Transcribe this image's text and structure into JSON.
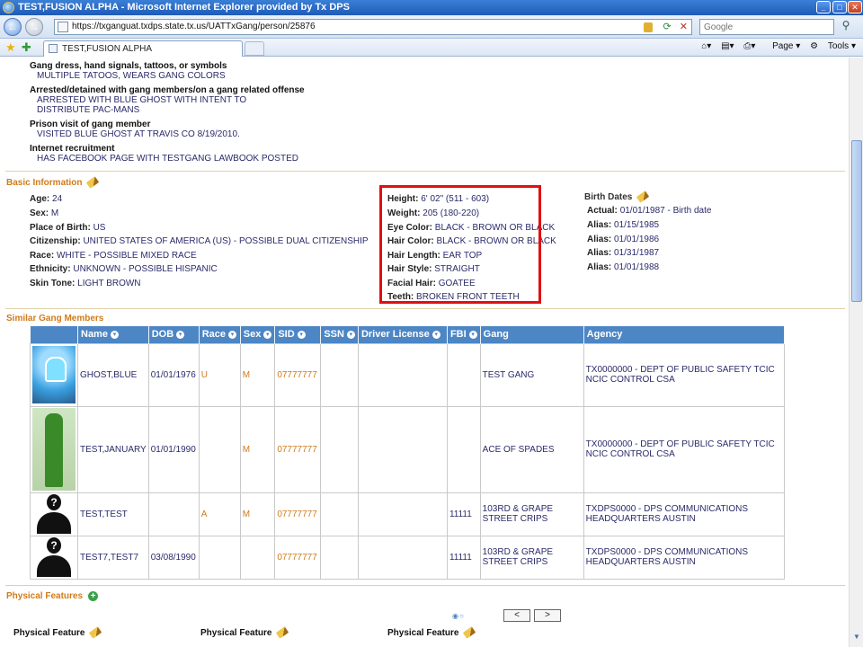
{
  "window": {
    "title": "TEST,FUSION ALPHA - Microsoft Internet Explorer provided by Tx DPS"
  },
  "browser": {
    "url": "https://txganguat.txdps.state.tx.us/UATTxGang/person/25876",
    "search_placeholder": "Google",
    "tab_label": "TEST,FUSION ALPHA",
    "cmd_page": "Page",
    "cmd_tools": "Tools"
  },
  "gang_indicators": [
    {
      "heading": "Gang dress, hand signals, tattoos, or symbols",
      "text": [
        "MULTIPLE TATOOS, WEARS GANG COLORS"
      ]
    },
    {
      "heading": "Arrested/detained with gang members/on a gang related offense",
      "text": [
        "ARRESTED WITH BLUE GHOST WITH INTENT TO",
        "DISTRIBUTE PAC-MANS"
      ]
    },
    {
      "heading": "Prison visit of gang member",
      "text": [
        "VISITED BLUE GHOST AT TRAVIS CO 8/19/2010."
      ]
    },
    {
      "heading": "Internet recruitment",
      "text": [
        "HAS FACEBOOK PAGE WITH TESTGANG LAWBOOK POSTED"
      ]
    }
  ],
  "basic_info": {
    "title": "Basic Information",
    "left": [
      {
        "label": "Age:",
        "value": "24"
      },
      {
        "label": "Sex:",
        "value": "M"
      },
      {
        "label": "Place of Birth:",
        "value": "US"
      },
      {
        "label": "Citizenship:",
        "value": "UNITED STATES OF AMERICA (US) - POSSIBLE DUAL CITIZENSHIP"
      },
      {
        "label": "Race:",
        "value": "WHITE - POSSIBLE MIXED RACE"
      },
      {
        "label": "Ethnicity:",
        "value": "UNKNOWN - POSSIBLE HISPANIC"
      },
      {
        "label": "Skin Tone:",
        "value": "LIGHT BROWN"
      }
    ],
    "middle": [
      {
        "label": "Height:",
        "value": "6' 02\" (511 - 603)"
      },
      {
        "label": "Weight:",
        "value": "205 (180-220)"
      },
      {
        "label": "Eye Color:",
        "value": "BLACK - BROWN OR BLACK"
      },
      {
        "label": "Hair Color:",
        "value": "BLACK - BROWN OR BLACK"
      },
      {
        "label": "Hair Length:",
        "value": "EAR TOP"
      },
      {
        "label": "Hair Style:",
        "value": "STRAIGHT"
      },
      {
        "label": "Facial Hair:",
        "value": "GOATEE"
      },
      {
        "label": "Teeth:",
        "value": "BROKEN FRONT TEETH"
      }
    ],
    "birth_dates_title": "Birth Dates",
    "birth_dates": [
      {
        "label": "Actual:",
        "value": "01/01/1987 - Birth date"
      },
      {
        "label": "Alias:",
        "value": "01/15/1985"
      },
      {
        "label": "Alias:",
        "value": "01/01/1986"
      },
      {
        "label": "Alias:",
        "value": "01/31/1987"
      },
      {
        "label": "Alias:",
        "value": "01/01/1988"
      }
    ]
  },
  "similar": {
    "title": "Similar Gang Members",
    "columns": [
      "Name",
      "DOB",
      "Race",
      "Sex",
      "SID",
      "SSN",
      "Driver License",
      "FBI",
      "Gang",
      "Agency"
    ],
    "rows": [
      {
        "name": "GHOST,BLUE",
        "dob": "01/01/1976",
        "race": "U",
        "sex": "M",
        "sid": "07777777",
        "ssn": "",
        "dl": "",
        "fbi": "",
        "gang": "TEST GANG",
        "agency": "TX0000000 - DEPT OF PUBLIC SAFETY TCIC NCIC CONTROL CSA"
      },
      {
        "name": "TEST,JANUARY",
        "dob": "01/01/1990",
        "race": "",
        "sex": "M",
        "sid": "07777777",
        "ssn": "",
        "dl": "",
        "fbi": "",
        "gang": "ACE OF SPADES",
        "agency": "TX0000000 - DEPT OF PUBLIC SAFETY TCIC NCIC CONTROL CSA"
      },
      {
        "name": "TEST,TEST",
        "dob": "",
        "race": "A",
        "sex": "M",
        "sid": "07777777",
        "ssn": "",
        "dl": "",
        "fbi": "11111",
        "gang": "103RD & GRAPE STREET CRIPS",
        "agency": "TXDPS0000 - DPS COMMUNICATIONS HEADQUARTERS AUSTIN"
      },
      {
        "name": "TEST7,TEST7",
        "dob": "03/08/1990",
        "race": "",
        "sex": "",
        "sid": "07777777",
        "ssn": "",
        "dl": "",
        "fbi": "11111",
        "gang": "103RD & GRAPE STREET CRIPS",
        "agency": "TXDPS0000 - DPS COMMUNICATIONS HEADQUARTERS AUSTIN"
      }
    ]
  },
  "physical": {
    "title": "Physical Features",
    "feature_label": "Physical Feature",
    "pager_prev": "<",
    "pager_next": ">"
  }
}
